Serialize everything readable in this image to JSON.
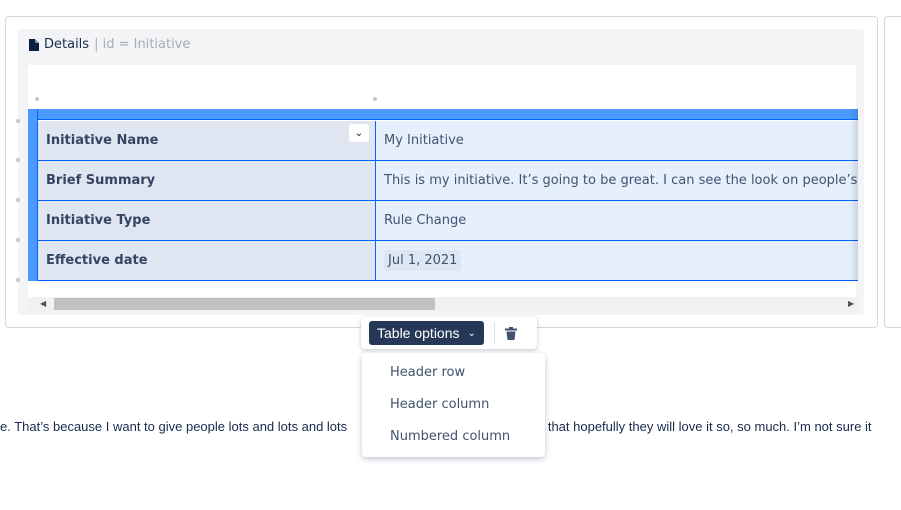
{
  "panel": {
    "title": "Details",
    "id_label": "| id = Initiative"
  },
  "table": {
    "rows": [
      {
        "label": "Initiative Name",
        "value": "My Initiative"
      },
      {
        "label": "Brief Summary",
        "value": "This is my initiative. It’s going to be great. I can see the look on people’s faces"
      },
      {
        "label": "Initiative Type",
        "value": "Rule Change"
      },
      {
        "label": "Effective date",
        "value": "Jul 1, 2021"
      }
    ]
  },
  "toolbar": {
    "table_options": "Table options"
  },
  "menu": {
    "items": [
      "Header row",
      "Header column",
      "Numbered column"
    ]
  },
  "paragraph": {
    "left": "e. That’s because I want to give people lots and lots and lots",
    "right": "o that hopefully they will love it so, so much. I’m not sure it"
  }
}
